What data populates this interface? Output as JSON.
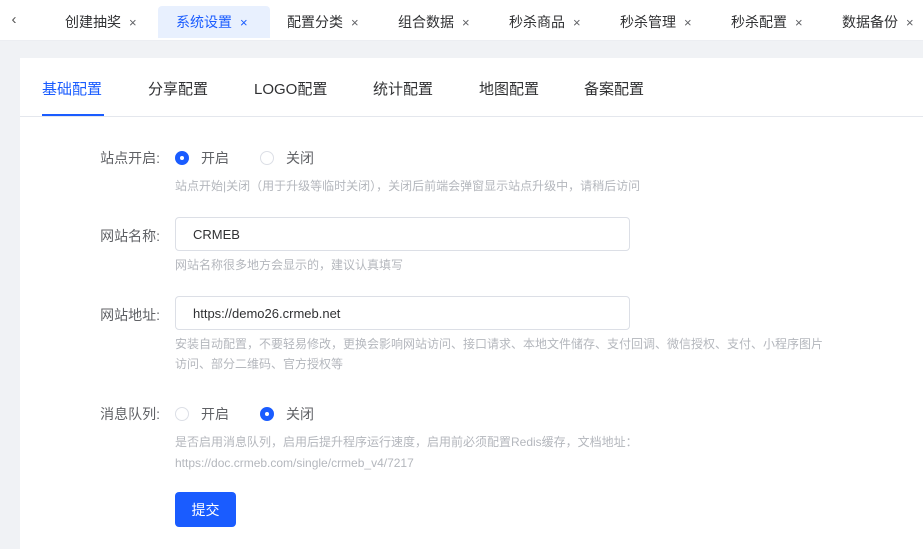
{
  "tabs": [
    {
      "label": "创建抽奖"
    },
    {
      "label": "系统设置"
    },
    {
      "label": "配置分类"
    },
    {
      "label": "组合数据"
    },
    {
      "label": "秒杀商品"
    },
    {
      "label": "秒杀管理"
    },
    {
      "label": "秒杀配置"
    },
    {
      "label": "数据备份"
    }
  ],
  "icons": {
    "prev": "‹",
    "close": "×"
  },
  "subtabs": [
    {
      "label": "基础配置"
    },
    {
      "label": "分享配置"
    },
    {
      "label": "LOGO配置"
    },
    {
      "label": "统计配置"
    },
    {
      "label": "地图配置"
    },
    {
      "label": "备案配置"
    }
  ],
  "form": {
    "site_open": {
      "label": "站点开启:",
      "options": [
        "开启",
        "关闭"
      ],
      "selected": "开启",
      "hint": "站点开始|关闭（用于升级等临时关闭），关闭后前端会弹窗显示站点升级中，请稍后访问"
    },
    "site_name": {
      "label": "网站名称:",
      "value": "CRMEB",
      "hint": "网站名称很多地方会显示的，建议认真填写"
    },
    "site_url": {
      "label": "网站地址:",
      "value": "https://demo26.crmeb.net",
      "hint_line1": "安装自动配置，不要轻易修改，更换会影响网站访问、接口请求、本地文件储存、支付回调、微信授权、支付、小程序图片",
      "hint_line2": "访问、部分二维码、官方授权等"
    },
    "message_queue": {
      "label": "消息队列:",
      "options": [
        "开启",
        "关闭"
      ],
      "selected": "关闭",
      "hint_line1": "是否启用消息队列，启用后提升程序运行速度，启用前必须配置Redis缓存，文档地址：",
      "hint_line2": "https://doc.crmeb.com/single/crmeb_v4/7217"
    },
    "submit_label": "提交"
  },
  "colors": {
    "accent": "#1a5cff",
    "active_tab_bg": "#e8f0fe",
    "hint": "#b4b7bd"
  }
}
